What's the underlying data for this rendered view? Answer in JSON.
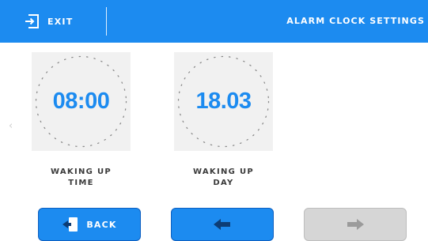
{
  "header": {
    "exit_label": "EXIT",
    "title": "ALARM CLOCK SETTINGS",
    "background_color": "#1c8bf0"
  },
  "tiles": [
    {
      "value": "08:00",
      "caption_line1": "WAKING UP",
      "caption_line2": "TIME"
    },
    {
      "value": "18.03",
      "caption_line1": "WAKING UP",
      "caption_line2": "DAY"
    }
  ],
  "footer": {
    "back_label": "BACK",
    "prev_icon": "arrow-left-icon",
    "next_icon": "arrow-right-icon",
    "next_enabled": false
  },
  "nav": {
    "left_arrow_glyph": "‹"
  },
  "colors": {
    "accent": "#1c8bf0",
    "disabled": "#d6d6d6"
  }
}
